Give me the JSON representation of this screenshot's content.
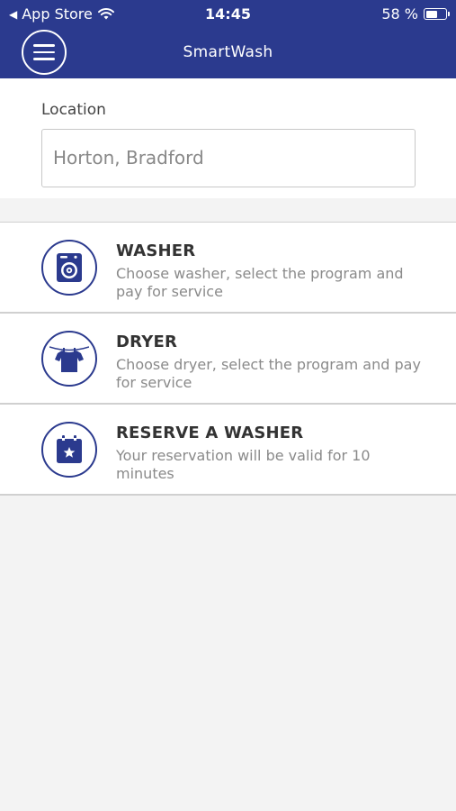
{
  "status_bar": {
    "back_label": "App Store",
    "time": "14:45",
    "battery_text": "58 %",
    "battery_level": 0.58
  },
  "header": {
    "title": "SmartWash"
  },
  "location": {
    "label": "Location",
    "value": "Horton, Bradford"
  },
  "services": [
    {
      "title": "WASHER",
      "description": "Choose washer, select the program and pay for service",
      "icon": "washing-machine-icon"
    },
    {
      "title": "DRYER",
      "description": "Choose dryer, select the program and pay for service",
      "icon": "shirt-icon"
    },
    {
      "title": "RESERVE A WASHER",
      "description": "Your reservation will be valid for 10 minutes",
      "icon": "calendar-star-icon"
    }
  ],
  "colors": {
    "brand": "#2b3a8e",
    "background": "#f3f3f3"
  }
}
